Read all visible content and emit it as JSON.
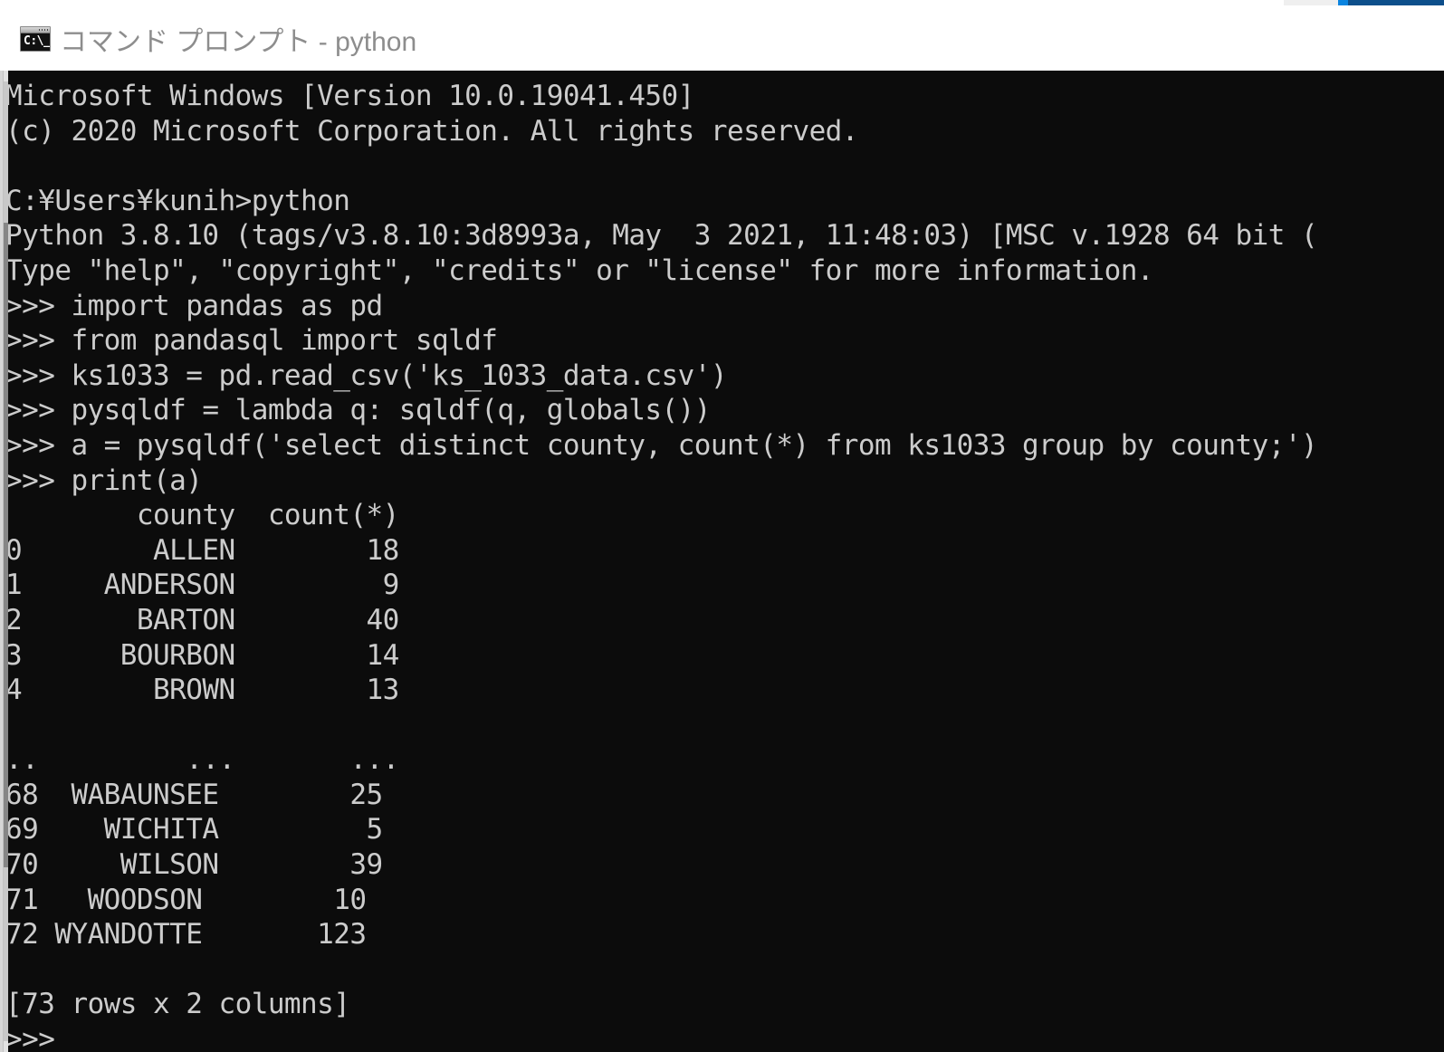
{
  "window": {
    "title": "コマンド プロンプト - python",
    "icon_name": "command-prompt-icon",
    "icon_glyph": "C:\\_",
    "background_color": "#0c0c0c",
    "foreground_color": "#cccccc",
    "titlebar_color": "#ffffff",
    "title_color": "#8d8d8d"
  },
  "background_window": {
    "accent_color": "#0a84e0",
    "bar_color": "#0d4f8b",
    "gray_color": "#efefef"
  },
  "terminal": {
    "lines": [
      "Microsoft Windows [Version 10.0.19041.450]",
      "(c) 2020 Microsoft Corporation. All rights reserved.",
      "",
      "C:¥Users¥kunih>python",
      "Python 3.8.10 (tags/v3.8.10:3d8993a, May  3 2021, 11:48:03) [MSC v.1928 64 bit (",
      "Type \"help\", \"copyright\", \"credits\" or \"license\" for more information.",
      ">>> import pandas as pd",
      ">>> from pandasql import sqldf",
      ">>> ks1033 = pd.read_csv('ks_1033_data.csv')",
      ">>> pysqldf = lambda q: sqldf(q, globals())",
      ">>> a = pysqldf('select distinct county, count(*) from ks1033 group by county;')",
      ">>> print(a)",
      "        county  count(*)",
      "0        ALLEN        18",
      "1     ANDERSON         9",
      "2       BARTON        40",
      "3      BOURBON        14",
      "4        BROWN        13",
      "",
      "..         ...       ...",
      "68  WABAUNSEE        25",
      "69    WICHITA         5",
      "70     WILSON        39",
      "71   WOODSON        10",
      "72 WYANDOTTE       123",
      "",
      "[73 rows x 2 columns]",
      ">>>"
    ],
    "session": {
      "os_banner": "Microsoft Windows [Version 10.0.19041.450]",
      "copyright": "(c) 2020 Microsoft Corporation. All rights reserved.",
      "prompt_path": "C:¥Users¥kunih>",
      "launch_command": "python",
      "python_version_line": "Python 3.8.10 (tags/v3.8.10:3d8993a, May  3 2021, 11:48:03) [MSC v.1928 64 bit (",
      "help_line": "Type \"help\", \"copyright\", \"credits\" or \"license\" for more information.",
      "repl_prompt": ">>>"
    },
    "commands": [
      "import pandas as pd",
      "from pandasql import sqldf",
      "ks1033 = pd.read_csv('ks_1033_data.csv')",
      "pysqldf = lambda q: sqldf(q, globals())",
      "a = pysqldf('select distinct county, count(*) from ks1033 group by county;')",
      "print(a)"
    ],
    "dataframe": {
      "columns": [
        "county",
        "count(*)"
      ],
      "head_rows": [
        {
          "index": "0",
          "county": "ALLEN",
          "count": "18"
        },
        {
          "index": "1",
          "county": "ANDERSON",
          "count": "9"
        },
        {
          "index": "2",
          "county": "BARTON",
          "count": "40"
        },
        {
          "index": "3",
          "county": "BOURBON",
          "count": "14"
        },
        {
          "index": "4",
          "county": "BROWN",
          "count": "13"
        }
      ],
      "ellipsis_row": {
        "index": "..",
        "county": "...",
        "count": "..."
      },
      "tail_rows": [
        {
          "index": "68",
          "county": "WABAUNSEE",
          "count": "25"
        },
        {
          "index": "69",
          "county": "WICHITA",
          "count": "5"
        },
        {
          "index": "70",
          "county": "WILSON",
          "count": "39"
        },
        {
          "index": "71",
          "county": "WOODSON",
          "count": "10"
        },
        {
          "index": "72",
          "county": "WYANDOTTE",
          "count": "123"
        }
      ],
      "shape_note": "[73 rows x 2 columns]",
      "row_count": 73,
      "column_count": 2
    }
  }
}
